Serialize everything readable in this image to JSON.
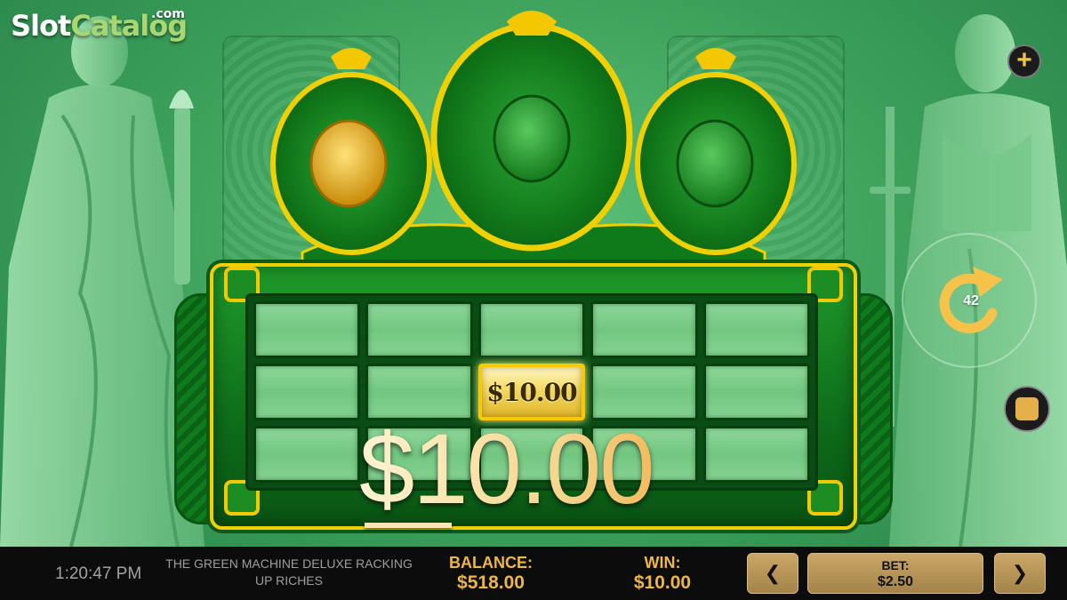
{
  "watermark": {
    "part1": "Slot",
    "part2": "Catalog",
    "suffix": ".com"
  },
  "reels": {
    "rows": 3,
    "cols": 5,
    "prize_symbol": {
      "row": 2,
      "col": 3,
      "label": "$10.00"
    }
  },
  "win_display": {
    "amount": "$10.00"
  },
  "controls": {
    "plus_icon": "plus-icon",
    "autospin_icon": "autospin-arrow-icon",
    "autospin_count": "42",
    "stop_icon": "stop-icon"
  },
  "status_bar": {
    "clock": "1:20:47 PM",
    "game_title": "THE GREEN MACHINE DELUXE RACKING UP RICHES",
    "balance_label": "BALANCE:",
    "balance_value": "$518.00",
    "win_label": "WIN:",
    "win_value": "$10.00",
    "bet_decrease": "❮",
    "bet_label": "BET:",
    "bet_value": "$2.50",
    "bet_increase": "❯"
  },
  "colors": {
    "accent_gold": "#ecb748",
    "frame_green": "#0e6d1a",
    "frame_gold": "#f0d000",
    "bar_bg": "#0c0c0c"
  }
}
